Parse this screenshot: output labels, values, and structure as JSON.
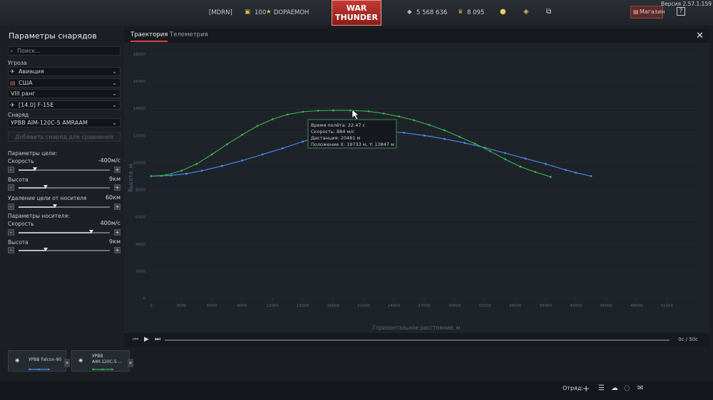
{
  "version": "Версия 2.57.1.159",
  "topbar": {
    "squadron": "[MDRN]",
    "level": "100",
    "nickname": "DOPAEMOH",
    "silver_lions": "5 568 636",
    "golden_eagles": "8 095",
    "shop_label": "Магазин",
    "logo_line1": "WAR",
    "logo_line2": "THUNDER",
    "help_label": "?"
  },
  "left_panel": {
    "title": "Параметры снарядов",
    "search_placeholder": "Поиск...",
    "threat_label": "Угроза",
    "threat_type": "Авиация",
    "country": "США",
    "rank": "VIII ранг",
    "vehicle": "[14.0] F-15E",
    "shell_label": "Снаряд",
    "shell": "УРВВ AIM-120C-5 AMRAAM",
    "add_shell_button": "Добавить снаряд для сравнения",
    "target_params_label": "Параметры цели:",
    "target_speed_label": "Скорость",
    "target_speed_value": "-400м/с",
    "target_speed_level": 0.18,
    "target_alt_label": "Высота",
    "target_alt_value": "9км",
    "target_alt_level": 0.3,
    "distance_label": "Удаление цели от носителя",
    "distance_value": "60км",
    "distance_level": 0.4,
    "carrier_params_label": "Параметры носителя:",
    "carrier_speed_label": "Скорость",
    "carrier_speed_value": "400м/с",
    "carrier_speed_level": 0.8,
    "carrier_alt_label": "Высота",
    "carrier_alt_value": "9км",
    "carrier_alt_level": 0.3
  },
  "tabs": [
    "Траектория",
    "Телеметрия"
  ],
  "active_tab": 0,
  "player": {
    "time": "0с / 50с"
  },
  "chart_data": {
    "type": "line",
    "xlabel": "Горизонтальное расстояние, м",
    "ylabel": "Высота, м",
    "xlim": [
      0,
      54000
    ],
    "ylim": [
      0,
      18000
    ],
    "x_ticks": [
      "0",
      "3000",
      "6000",
      "9000",
      "12000",
      "15000",
      "18000",
      "21000",
      "24000",
      "27000",
      "30000",
      "33000",
      "36000",
      "39000",
      "42000",
      "45000",
      "48000",
      "51000"
    ],
    "y_ticks": [
      "0",
      "2000",
      "4000",
      "6000",
      "8000",
      "10000",
      "12000",
      "14000",
      "16000",
      "18000"
    ],
    "series": [
      {
        "name": "УРВВ Falcon-90",
        "color": "#4a8fe8",
        "points": [
          [
            0,
            9000
          ],
          [
            1000,
            9020
          ],
          [
            2000,
            9060
          ],
          [
            3500,
            9180
          ],
          [
            5000,
            9400
          ],
          [
            7000,
            9750
          ],
          [
            9000,
            10150
          ],
          [
            11000,
            10600
          ],
          [
            13000,
            11050
          ],
          [
            15000,
            11550
          ],
          [
            17000,
            11950
          ],
          [
            19000,
            12200
          ],
          [
            21000,
            12300
          ],
          [
            23000,
            12300
          ],
          [
            25000,
            12200
          ],
          [
            27000,
            12000
          ],
          [
            29000,
            11750
          ],
          [
            31000,
            11450
          ],
          [
            33000,
            11100
          ],
          [
            35000,
            10700
          ],
          [
            37000,
            10300
          ],
          [
            39000,
            9900
          ],
          [
            41000,
            9450
          ],
          [
            42000,
            9250
          ],
          [
            43500,
            9000
          ]
        ]
      },
      {
        "name": "УРВВ AIM-120C-5 AMRAAM",
        "color": "#3bb54a",
        "points": [
          [
            0,
            9000
          ],
          [
            1500,
            9080
          ],
          [
            3000,
            9400
          ],
          [
            4500,
            9900
          ],
          [
            6000,
            10600
          ],
          [
            7500,
            11350
          ],
          [
            9000,
            12050
          ],
          [
            10500,
            12700
          ],
          [
            12000,
            13200
          ],
          [
            13500,
            13550
          ],
          [
            15000,
            13750
          ],
          [
            16500,
            13830
          ],
          [
            18000,
            13850
          ],
          [
            19700,
            13847
          ],
          [
            21500,
            13780
          ],
          [
            23000,
            13620
          ],
          [
            24500,
            13400
          ],
          [
            26000,
            13120
          ],
          [
            27500,
            12780
          ],
          [
            29000,
            12380
          ],
          [
            30500,
            11900
          ],
          [
            32000,
            11400
          ],
          [
            33500,
            10850
          ],
          [
            35000,
            10250
          ],
          [
            36500,
            9700
          ],
          [
            38000,
            9300
          ],
          [
            39500,
            8950
          ]
        ]
      }
    ],
    "tooltip": {
      "lines": [
        "Время полёта: 22.47 с",
        "Скорость: 884 м/с",
        "Дистанция: 20481 м",
        "Положение X: 19733 м, Y: 13847 м"
      ]
    }
  },
  "cards": [
    {
      "name": "УРВВ Falcon-90",
      "close": "×"
    },
    {
      "name_line1": "УРВВ",
      "name_line2": "AIM-120C-5 ...",
      "close": "×"
    }
  ],
  "bottombar": {
    "squad_label": "Отряд:"
  }
}
